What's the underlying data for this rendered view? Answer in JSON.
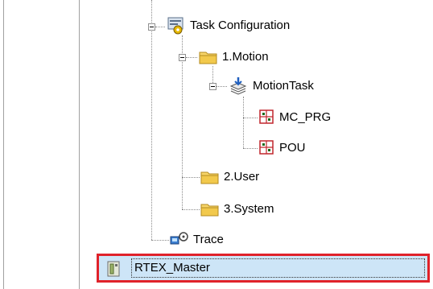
{
  "tree": {
    "task_configuration": {
      "label": "Task Configuration",
      "icon": "task-configuration-icon"
    },
    "motion_folder": {
      "label": "1.Motion",
      "icon": "folder-icon"
    },
    "motion_task": {
      "label": "MotionTask",
      "icon": "task-icon"
    },
    "mc_prg": {
      "label": "MC_PRG",
      "icon": "pou-icon"
    },
    "pou": {
      "label": "POU",
      "icon": "pou-icon"
    },
    "user_folder": {
      "label": "2.User",
      "icon": "folder-icon"
    },
    "system_folder": {
      "label": "3.System",
      "icon": "folder-icon"
    },
    "trace": {
      "label": "Trace",
      "icon": "trace-icon"
    },
    "rtex_master": {
      "label": "RTEX_Master",
      "icon": "device-icon",
      "selected": true
    }
  },
  "colors": {
    "selection_fill": "#cde5f7",
    "selection_border": "#e0222a",
    "folder": "#f2c94c"
  }
}
